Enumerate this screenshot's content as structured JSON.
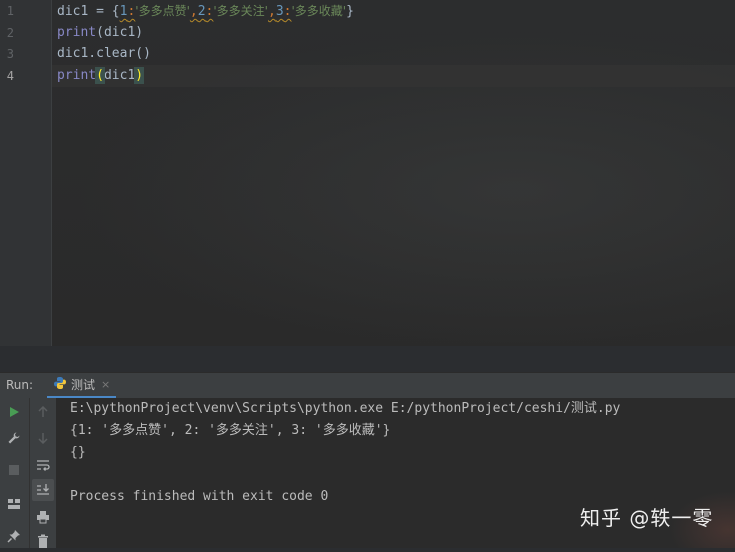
{
  "editor": {
    "line_numbers": [
      "1",
      "2",
      "3",
      "4"
    ],
    "current_line": 4,
    "lines": [
      {
        "p1": "dic1 = {",
        "k1": "1",
        "c1": ":",
        "s1": "'多多点赞'",
        "sep1": ",",
        "k2": "2",
        "c2": ":",
        "s2": "'多多关注'",
        "sep2": ",",
        "k3": "3",
        "c3": ":",
        "s3": "'多多收藏'",
        "p2": "}"
      },
      {
        "fn": "print",
        "rest": "(dic1)"
      },
      {
        "text": "dic1.clear()"
      },
      {
        "fn": "print",
        "open": "(",
        "arg": "dic1",
        "close": ")"
      }
    ]
  },
  "run_panel": {
    "label": "Run:",
    "tab_label": "测试",
    "tab_close": "×",
    "output": [
      "E:\\pythonProject\\venv\\Scripts\\python.exe E:/pythonProject/ceshi/测试.py",
      "{1: '多多点赞', 2: '多多关注', 3: '多多收藏'}",
      "{}",
      "",
      "Process finished with exit code 0"
    ],
    "tools_left": [
      "run-icon",
      "wrench-icon",
      "stop-icon",
      "layout-icon",
      "pin-icon"
    ],
    "tools_right": [
      "up-arrow-icon",
      "down-arrow-icon",
      "soft-wrap-icon",
      "scroll-to-end-icon",
      "print-icon",
      "trash-icon"
    ]
  },
  "watermark": "知乎 @轶一零",
  "colors": {
    "editor_bg": "#2b2b2b",
    "gutter_bg": "#313335",
    "keyword_fn": "#8888c6",
    "number": "#6897bb",
    "string": "#6a8759",
    "text": "#a9b7c6",
    "run_green": "#499c54",
    "tab_underline": "#4a88c7"
  }
}
